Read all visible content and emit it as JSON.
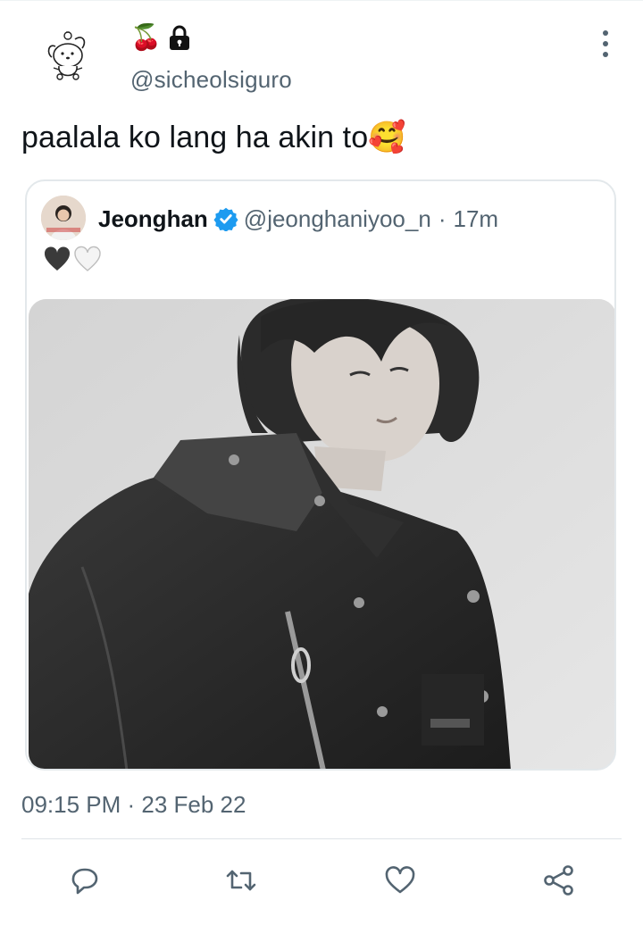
{
  "header": {
    "badge_cherry": "🍒",
    "handle": "@sicheolsiguro"
  },
  "tweet": {
    "text": "paalala ko lang ha akin to🥰",
    "timestamp": "09:15 PM · 23 Feb 22"
  },
  "quote": {
    "name": "Jeonghan",
    "handle": "@jeonghaniyoo_n",
    "separator": "·",
    "time": "17m",
    "hearts": [
      "black-heart",
      "white-heart"
    ]
  },
  "icons": {
    "reply": "reply-icon",
    "retweet": "retweet-icon",
    "like": "like-icon",
    "share": "share-icon",
    "more": "more-icon",
    "lock": "lock-icon",
    "verified": "verified-icon"
  },
  "colors": {
    "text_primary": "#0f1419",
    "text_secondary": "#536471",
    "verified": "#1d9bf0",
    "border": "#e3e8eb"
  }
}
